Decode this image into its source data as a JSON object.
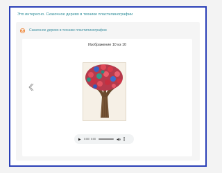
{
  "page": {
    "title": "Это интересно. Сказочное дерево в технике пластилинографии"
  },
  "panel": {
    "title": "Сказочное дерево в технике пластилинографии",
    "icon": "eye-icon",
    "accent": "#ee7a22"
  },
  "viewer": {
    "counter": "Изображение 10 из 10",
    "prev_icon": "chevron-left-icon",
    "image_alt": "plasticine tree artwork"
  },
  "audio": {
    "time": "0:00 / 0:00",
    "icons": [
      "play-icon",
      "volume-icon",
      "more-vert-icon"
    ]
  },
  "colors": {
    "frame_border": "#2a3fb6",
    "title_text": "#2f8e9a"
  }
}
